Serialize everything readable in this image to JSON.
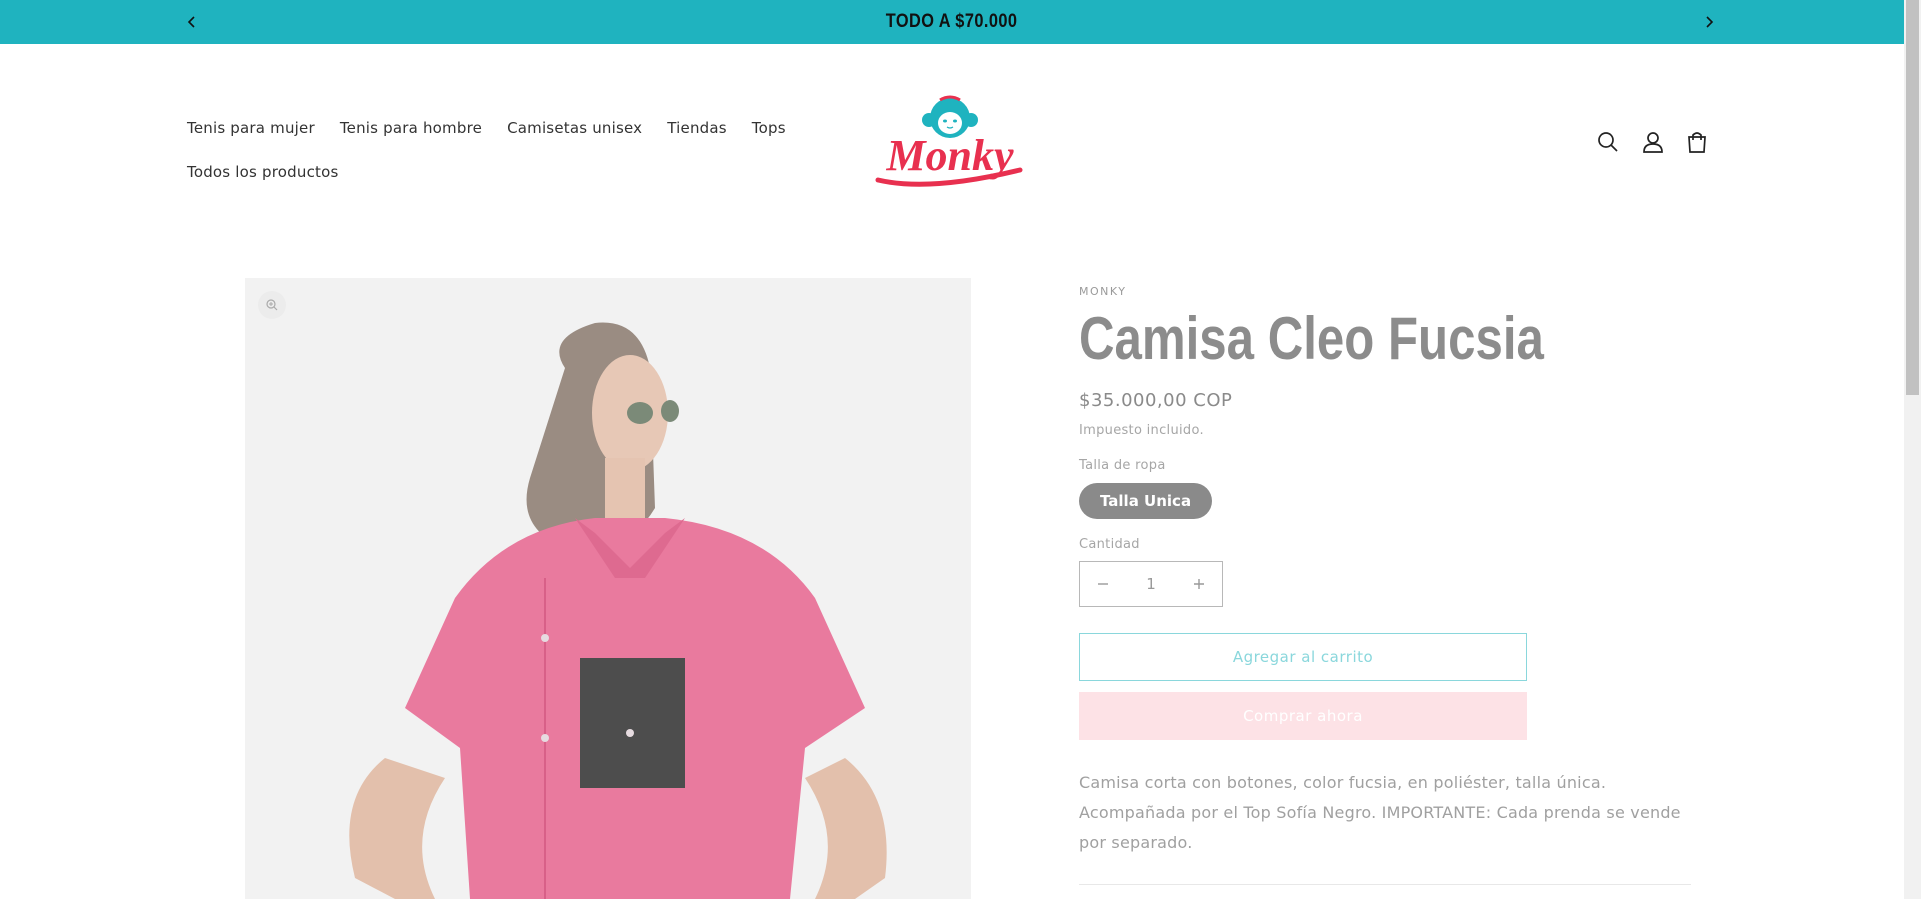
{
  "announcement": {
    "text": "TODO A $70.000",
    "prev_icon": "chevron-left-icon",
    "next_icon": "chevron-right-icon"
  },
  "nav": {
    "row1": [
      "Tenis para mujer",
      "Tenis para hombre",
      "Camisetas unisex",
      "Tiendas",
      "Tops"
    ],
    "row2": [
      "Todos los productos"
    ]
  },
  "logo": {
    "text": "Monky"
  },
  "header_icons": [
    "search-icon",
    "account-icon",
    "cart-icon"
  ],
  "product": {
    "vendor": "MONKY",
    "title": "Camisa Cleo Fucsia",
    "price": "$35.000,00 COP",
    "tax_note": "Impuesto incluido.",
    "size_label": "Talla de ropa",
    "size_option": "Talla Unica",
    "quantity_label": "Cantidad",
    "quantity": "1",
    "add_to_cart": "Agregar al carrito",
    "buy_now": "Comprar ahora",
    "description_lines": [
      "Camisa corta con botones, color fucsia, en poliéster, talla única.",
      "Acompañada por el Top Sofía Negro. IMPORTANTE: Cada prenda se vende",
      "por separado."
    ]
  },
  "colors": {
    "announcement_bg": "#1fb3bf",
    "brand_teal": "#1fb3bf",
    "brand_red": "#e8304f"
  }
}
